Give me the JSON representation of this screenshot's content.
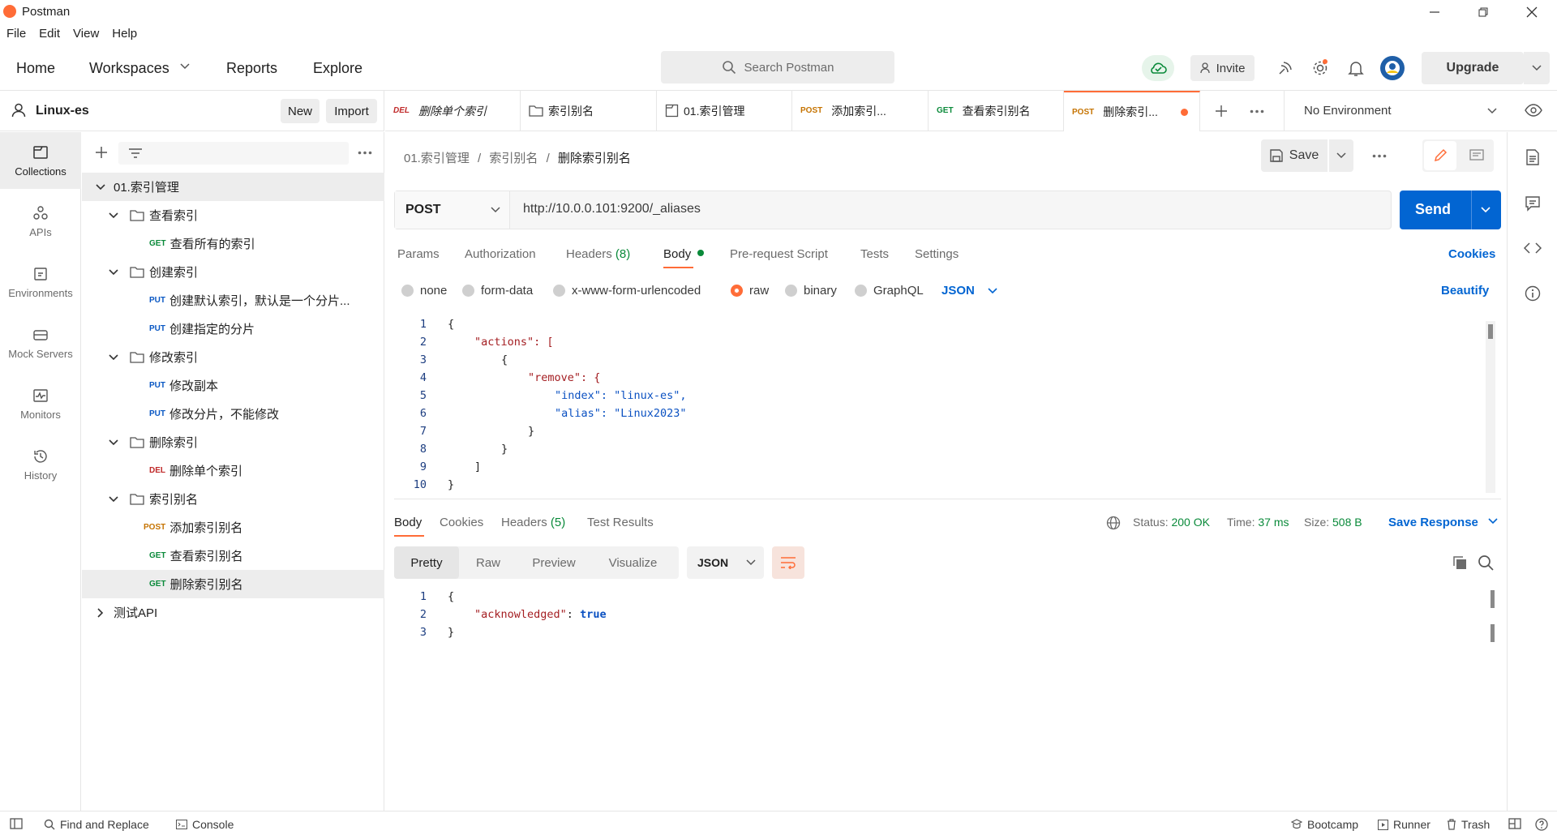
{
  "app": {
    "title": "Postman"
  },
  "menu": [
    "File",
    "Edit",
    "View",
    "Help"
  ],
  "header": {
    "nav": [
      "Home",
      "Workspaces",
      "Reports",
      "Explore"
    ],
    "search_placeholder": "Search Postman",
    "invite_label": "Invite",
    "upgrade_label": "Upgrade"
  },
  "workspace": {
    "name": "Linux-es",
    "new_label": "New",
    "import_label": "Import"
  },
  "rail": [
    {
      "label": "Collections",
      "icon": "collections-icon"
    },
    {
      "label": "APIs",
      "icon": "apis-icon"
    },
    {
      "label": "Environments",
      "icon": "environments-icon"
    },
    {
      "label": "Mock Servers",
      "icon": "mock-servers-icon"
    },
    {
      "label": "Monitors",
      "icon": "monitors-icon"
    },
    {
      "label": "History",
      "icon": "history-icon"
    }
  ],
  "tree": {
    "root": "01.索引管理",
    "folders": [
      {
        "name": "查看索引",
        "requests": [
          {
            "method": "GET",
            "name": "查看所有的索引"
          }
        ]
      },
      {
        "name": "创建索引",
        "requests": [
          {
            "method": "PUT",
            "name": "创建默认索引，默认是一个分片..."
          },
          {
            "method": "PUT",
            "name": "创建指定的分片"
          }
        ]
      },
      {
        "name": "修改索引",
        "requests": [
          {
            "method": "PUT",
            "name": "修改副本"
          },
          {
            "method": "PUT",
            "name": "修改分片，不能修改"
          }
        ]
      },
      {
        "name": "删除索引",
        "requests": [
          {
            "method": "DEL",
            "name": "删除单个索引"
          }
        ]
      },
      {
        "name": "索引别名",
        "requests": [
          {
            "method": "POST",
            "name": "添加索引别名"
          },
          {
            "method": "GET",
            "name": "查看索引别名"
          },
          {
            "method": "GET",
            "name": "删除索引别名"
          }
        ]
      }
    ],
    "other": "测试API"
  },
  "tabs": [
    {
      "method": "DEL",
      "name": "删除单个索引"
    },
    {
      "method": "",
      "name": "索引别名"
    },
    {
      "method": "",
      "name": "01.索引管理"
    },
    {
      "method": "POST",
      "name": "添加索引..."
    },
    {
      "method": "GET",
      "name": "查看索引别名"
    },
    {
      "method": "POST",
      "name": "删除索引..."
    }
  ],
  "environment": "No Environment",
  "breadcrumb": {
    "a": "01.索引管理",
    "b": "索引别名",
    "c": "删除索引别名",
    "sep": "/"
  },
  "request": {
    "save_label": "Save",
    "method": "POST",
    "url": "http://10.0.0.101:9200/_aliases",
    "send_label": "Send",
    "tabs": [
      "Params",
      "Authorization",
      "Headers",
      "Body",
      "Pre-request Script",
      "Tests",
      "Settings"
    ],
    "headers_count": "(8)",
    "cookies_label": "Cookies",
    "body_types": [
      "none",
      "form-data",
      "x-www-form-urlencoded",
      "raw",
      "binary",
      "GraphQL"
    ],
    "body_format": "JSON",
    "beautify_label": "Beautify",
    "body_lines": [
      {
        "n": "1",
        "text": "{"
      },
      {
        "n": "2",
        "text": "\"actions\": ["
      },
      {
        "n": "3",
        "text": "{"
      },
      {
        "n": "4",
        "text": "\"remove\": {"
      },
      {
        "n": "5",
        "text": "\"index\": \"linux-es\","
      },
      {
        "n": "6",
        "text": "\"alias\": \"Linux2023\""
      },
      {
        "n": "7",
        "text": "}"
      },
      {
        "n": "8",
        "text": "}"
      },
      {
        "n": "9",
        "text": "]"
      },
      {
        "n": "10",
        "text": "}"
      }
    ]
  },
  "response": {
    "tabs": [
      "Body",
      "Cookies",
      "Headers",
      "Test Results"
    ],
    "headers_count": "(5)",
    "status_label": "Status:",
    "status_value": "200 OK",
    "time_label": "Time:",
    "time_value": "37 ms",
    "size_label": "Size:",
    "size_value": "508 B",
    "save_response_label": "Save Response",
    "views": [
      "Pretty",
      "Raw",
      "Preview",
      "Visualize"
    ],
    "format": "JSON",
    "lines": [
      {
        "n": "1",
        "text": "{"
      },
      {
        "n": "2",
        "key": "\"acknowledged\"",
        "value": "true"
      },
      {
        "n": "3",
        "text": "}"
      }
    ]
  },
  "statusbar": {
    "find_replace": "Find and Replace",
    "console": "Console",
    "bootcamp": "Bootcamp",
    "runner": "Runner",
    "trash": "Trash"
  },
  "colors": {
    "accent": "#ff6c37",
    "send": "#0265d2",
    "status_ok": "#0a8a3a"
  }
}
